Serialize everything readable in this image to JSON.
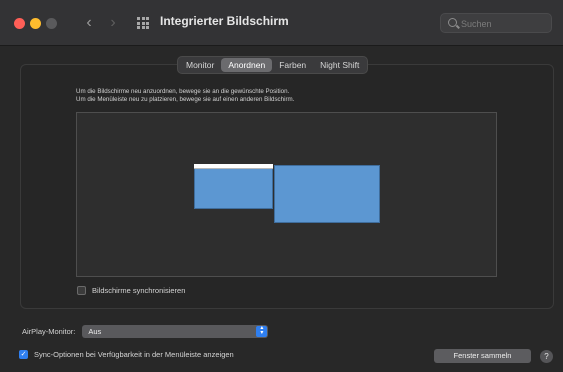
{
  "window": {
    "title": "Integrierter Bildschirm"
  },
  "toolbar": {
    "back_icon": "‹",
    "forward_icon": "›"
  },
  "search": {
    "placeholder": "Suchen",
    "value": ""
  },
  "tabs": [
    {
      "label": "Monitor",
      "active": false
    },
    {
      "label": "Anordnen",
      "active": true
    },
    {
      "label": "Farben",
      "active": false
    },
    {
      "label": "Night Shift",
      "active": false
    }
  ],
  "arrange": {
    "hint_line1": "Um die Bildschirme neu anzuordnen, bewege sie an die gewünschte Position.",
    "hint_line2": "Um die Menüleiste neu zu platzieren, bewege sie auf einen anderen Bildschirm.",
    "mirror_label": "Bildschirme synchronisieren",
    "mirror_checked": false
  },
  "airplay": {
    "label": "AirPlay-Monitor:",
    "value": "Aus"
  },
  "bottom": {
    "sync_label": "Sync-Optionen bei Verfügbarkeit in der Menüleiste anzeigen",
    "sync_checked": true,
    "gather_button": "Fenster sammeln",
    "help_label": "?"
  },
  "colors": {
    "accent": "#2f7ff0",
    "display_fill": "#5c97d2",
    "close": "#ff5f57",
    "minimize": "#febc2e"
  }
}
